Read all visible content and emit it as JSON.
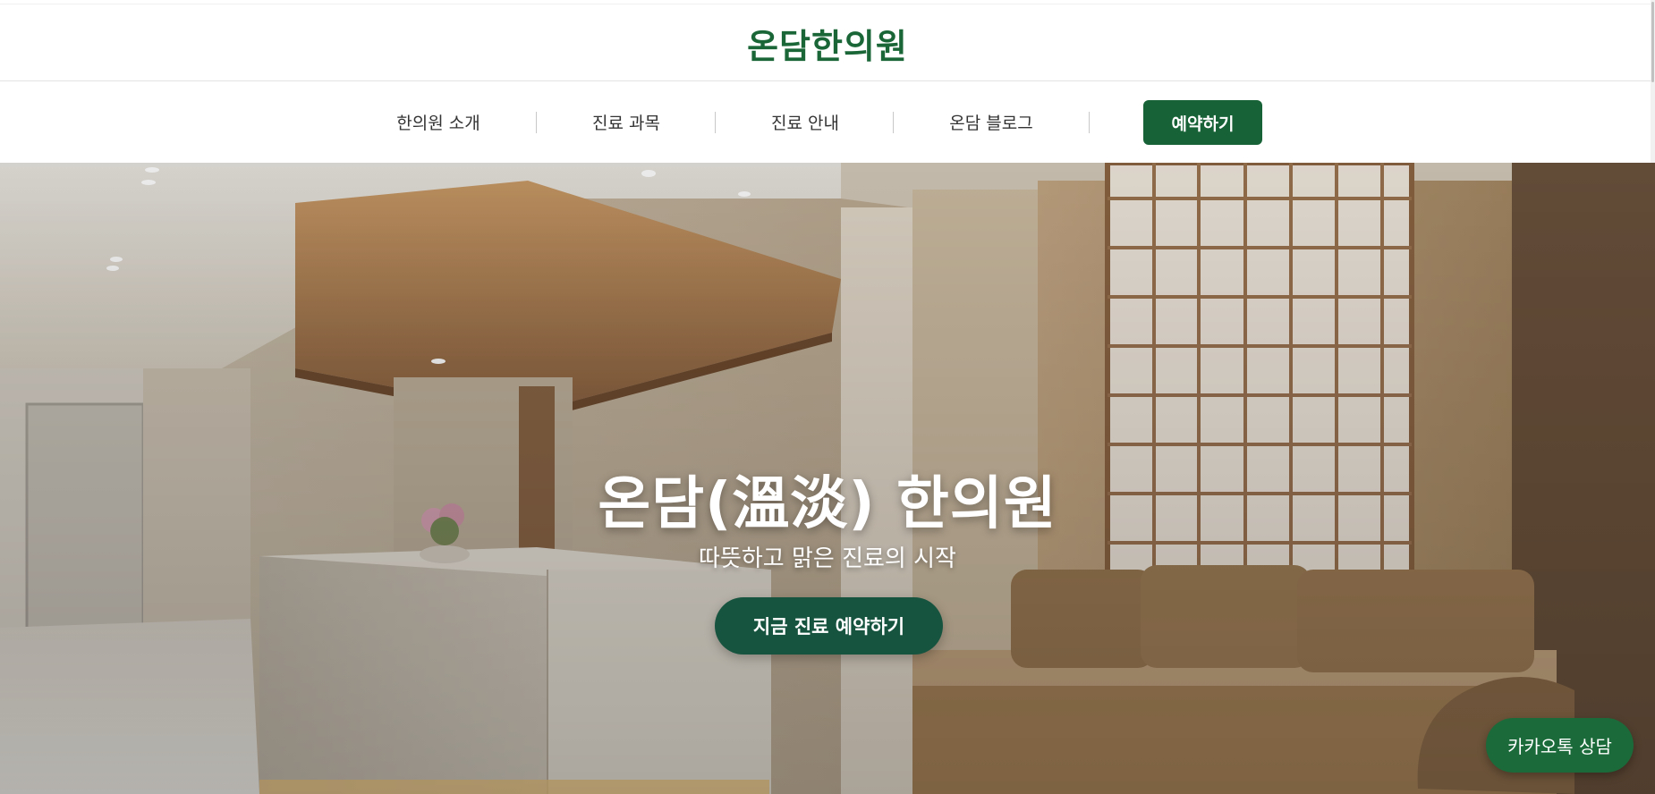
{
  "header": {
    "logo": "온담한의원"
  },
  "nav": {
    "items": [
      {
        "label": "한의원 소개"
      },
      {
        "label": "진료 과목"
      },
      {
        "label": "진료 안내"
      },
      {
        "label": "온담 블로그"
      }
    ],
    "reserve_label": "예약하기"
  },
  "hero": {
    "title": "온담(溫淡) 한의원",
    "subtitle": "따뜻하고 맑은 진료의 시작",
    "cta_label": "지금 진료 예약하기"
  },
  "floating": {
    "kakao_label": "카카오톡 상담"
  },
  "colors": {
    "brand_green": "#1a6637",
    "button_green": "#176236",
    "cta_green": "#175440",
    "kakao_green": "#1b6b3a"
  }
}
